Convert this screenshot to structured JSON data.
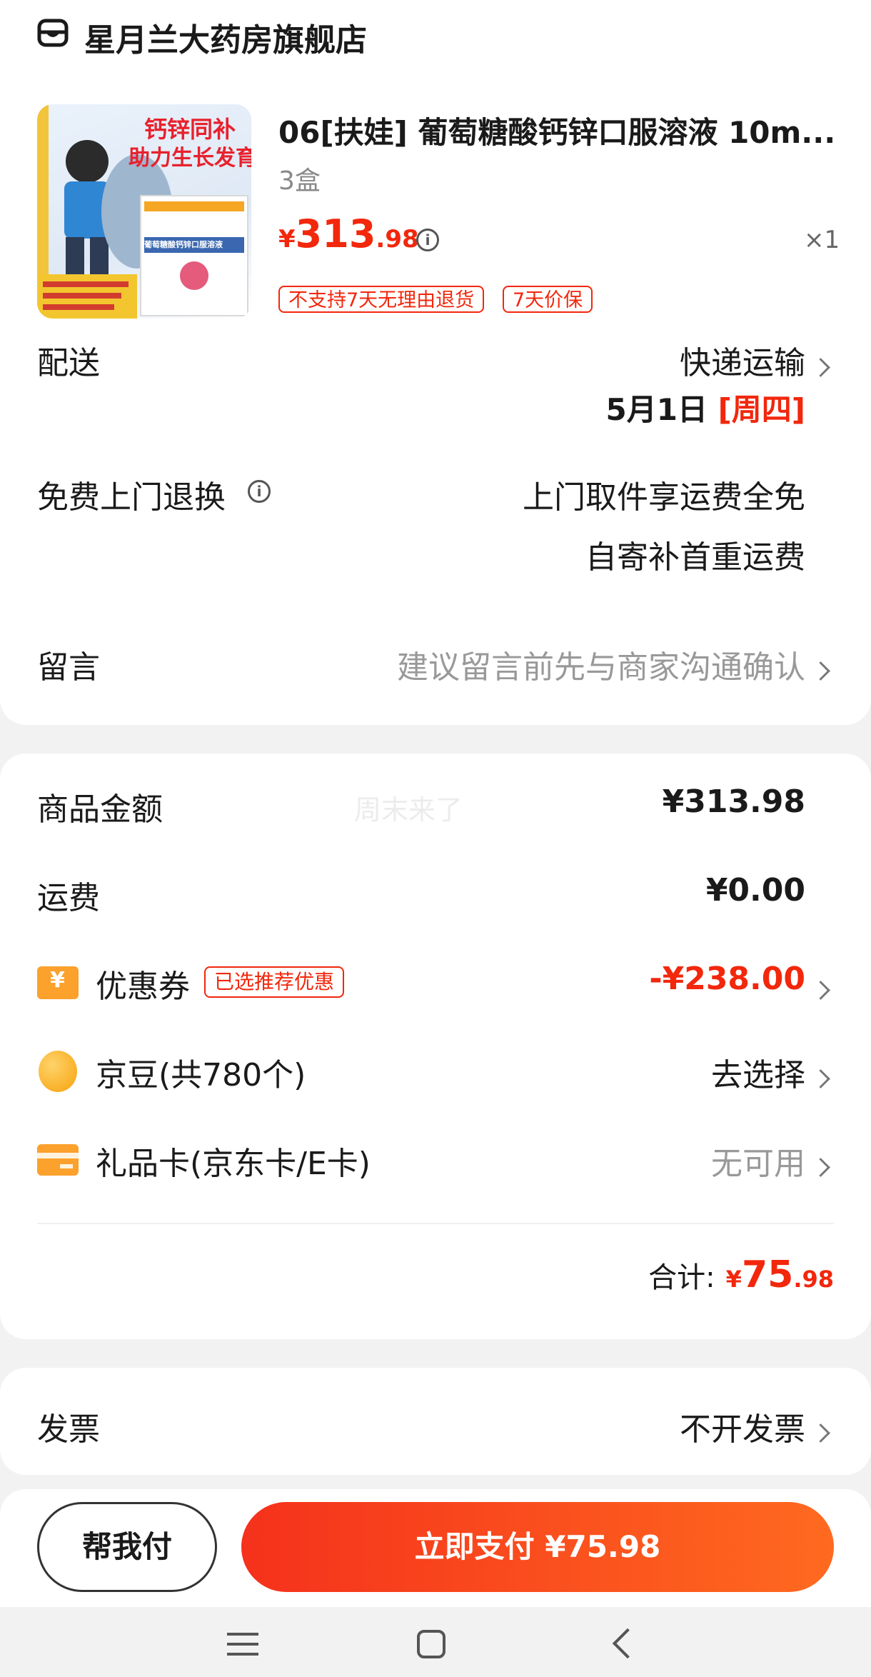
{
  "store": {
    "name": "星月兰大药房旗舰店",
    "icon": "store-icon"
  },
  "product": {
    "image": {
      "headline_1": "钙锌同补",
      "headline_2": "助力生长发育",
      "box_label": "葡萄糖酸钙锌口服溶液",
      "icon": "product-image"
    },
    "title": "06[扶娃] 葡萄糖酸钙锌口服溶液 10m...",
    "spec": "3盒",
    "currency": "¥",
    "price_int": "313",
    "price_dec": ".98",
    "quantity": "×1",
    "tags": [
      "不支持7天无理由退货",
      "7天价保"
    ]
  },
  "delivery": {
    "label": "配送",
    "method": "快递运输",
    "date": "5月1日",
    "weekday": "[周四]"
  },
  "return_service": {
    "label": "免费上门退换",
    "line1": "上门取件享运费全免",
    "line2": "自寄补首重运费"
  },
  "message": {
    "label": "留言",
    "placeholder": "建议留言前先与商家沟通确认"
  },
  "summary": {
    "goods_label": "商品金额",
    "goods_value": "¥313.98",
    "watermark": "周末来了",
    "shipping_label": "运费",
    "shipping_value": "¥0.00",
    "coupon_label": "优惠券",
    "coupon_tag": "已选推荐优惠",
    "coupon_value": "-¥238.00",
    "beans_label": "京豆(共780个)",
    "beans_value": "去选择",
    "giftcard_label": "礼品卡(京东卡/E卡)",
    "giftcard_value": "无可用",
    "total_label": "合计:",
    "total_currency": "¥",
    "total_int": "75",
    "total_dec": ".98"
  },
  "invoice": {
    "label": "发票",
    "value": "不开发票"
  },
  "actions": {
    "help_pay": "帮我付",
    "pay_now": "立即支付 ¥75.98"
  },
  "colors": {
    "accent": "#f2270c",
    "pay_gradient_start": "#f5311c",
    "pay_gradient_end": "#ff6a1f"
  }
}
